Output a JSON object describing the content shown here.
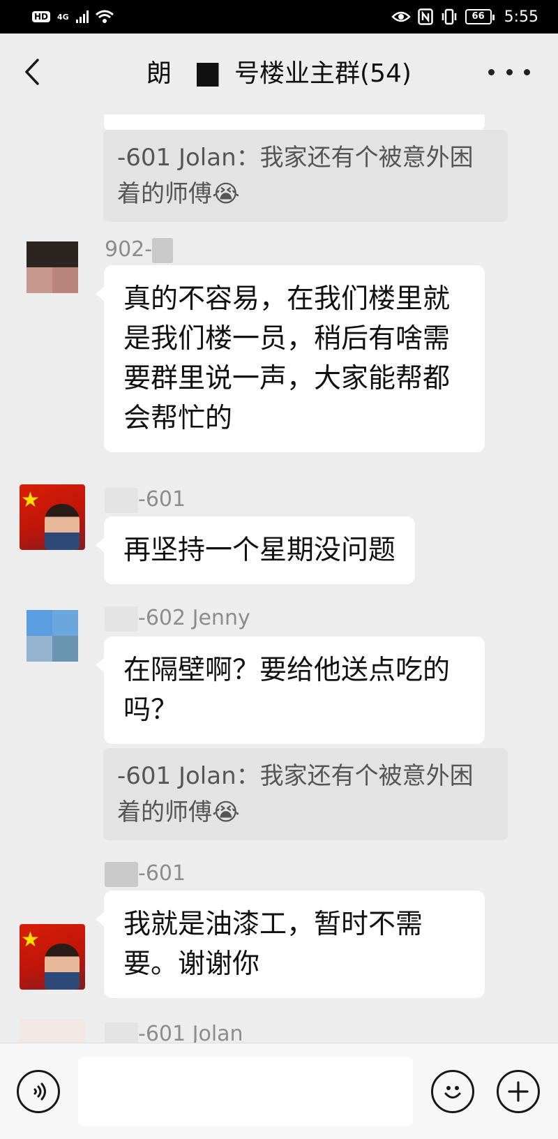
{
  "status_bar": {
    "hd": "HD",
    "network": "4G",
    "battery": "66",
    "time": "5:55"
  },
  "header": {
    "title_prefix": "朗",
    "title_suffix": "号楼业主群(54)"
  },
  "messages": {
    "quote1": {
      "text": "-601 Jolan：我家还有个被意外困着的师傅😭"
    },
    "m1": {
      "sender": "902-",
      "text": "真的不容易，在我们楼里就是我们楼一员，稍后有啥需要群里说一声，大家能帮都会帮忙的"
    },
    "m2": {
      "sender": "-601",
      "text": "再坚持一个星期没问题"
    },
    "m3": {
      "sender": "-602 Jenny",
      "text": "在隔壁啊？要给他送点吃的吗？"
    },
    "quote2": {
      "text": "-601 Jolan：我家还有个被意外困着的师傅😭"
    },
    "m4": {
      "sender": "-601",
      "text": "我就是油漆工，暂时不需要。谢谢你"
    },
    "m5": {
      "sender": "-601 Jolan"
    }
  },
  "input": {
    "value": "",
    "placeholder": ""
  },
  "colors": {
    "background": "#ededed",
    "bubble": "#ffffff",
    "quote": "#e3e3e3",
    "sender": "#8c8c8c"
  },
  "icons": [
    "back-arrow-icon",
    "more-dots-icon",
    "voice-icon",
    "emoji-icon",
    "plus-icon"
  ]
}
